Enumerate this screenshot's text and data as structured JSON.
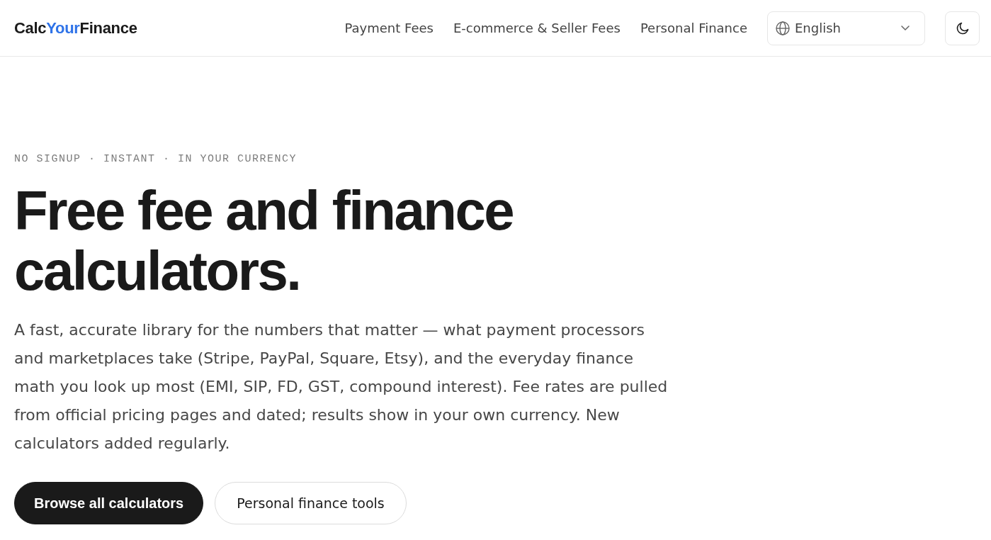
{
  "header": {
    "logo": {
      "prefix": "Calc",
      "highlight": "Your",
      "suffix": "Finance"
    },
    "nav_links": [
      "Payment Fees",
      "E-commerce & Seller Fees",
      "Personal Finance"
    ],
    "language_select": {
      "value": "English"
    }
  },
  "hero": {
    "eyebrow": "NO SIGNUP · INSTANT · IN YOUR CURRENCY",
    "headline": "Free fee and finance calculators.",
    "description": "A fast, accurate library for the numbers that matter — what payment processors and marketplaces take (Stripe, PayPal, Square, Etsy), and the everyday finance math you look up most (EMI, SIP, FD, GST, compound interest). Fee rates are pulled from official pricing pages and dated; results show in your own currency. New calculators added regularly.",
    "buttons": [
      {
        "label": "Browse all calculators",
        "kind": "primary"
      },
      {
        "label": "Personal finance tools",
        "kind": "secondary"
      }
    ]
  }
}
